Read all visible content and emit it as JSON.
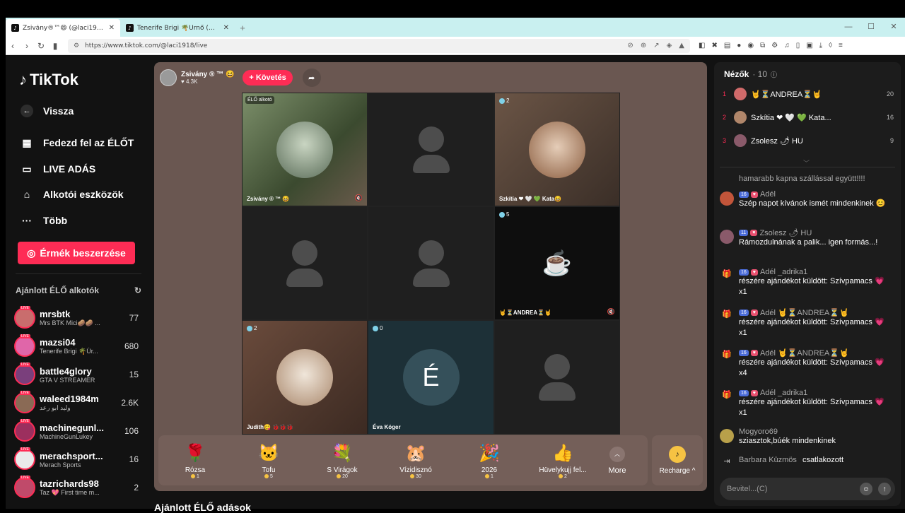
{
  "browser": {
    "tabs": [
      {
        "title": "Zsivány®™😄 (@laci1918) É..."
      },
      {
        "title": "Tenerife Brigi 🌴Ürnő (@mazsi04) É..."
      }
    ],
    "url": "https://www.tiktok.com/@laci1918/live"
  },
  "sidebar": {
    "logo": "TikTok",
    "back": "Vissza",
    "nav": [
      "Fedezd fel az ÉLŐT",
      "LIVE ADÁS",
      "Alkotói eszközök",
      "Több"
    ],
    "coins_button": "Érmék beszerzése",
    "recommended_title": "Ajánlott ÉLŐ alkotók",
    "creators": [
      {
        "name": "mrsbtk",
        "sub": "Mrs BTK Mici🥔🥔 ...",
        "count": "77"
      },
      {
        "name": "mazsi04",
        "sub": "Tenerife Brigi 🌴Úr...",
        "count": "680"
      },
      {
        "name": "battle4glory",
        "sub": "GTA V STREAMER",
        "count": "15"
      },
      {
        "name": "waleed1984m",
        "sub": "وليد ابو رعد",
        "count": "2.6K"
      },
      {
        "name": "machinegunl...",
        "sub": "MachineGunLukey",
        "count": "106"
      },
      {
        "name": "merachsport...",
        "sub": "Merach Sports",
        "count": "16"
      },
      {
        "name": "tazrichards98",
        "sub": "Taz 💖 First time m...",
        "count": "2"
      }
    ]
  },
  "live": {
    "host_name": "Zsivány ® ™ 😆",
    "host_likes": "♥ 4.3K",
    "follow_label": "+ Követés",
    "cells": [
      {
        "label": "Zsivány ® ™ 😆",
        "badge": "",
        "tag": "ÉLŐ alkotó",
        "muted": true
      },
      {
        "label": "",
        "badge": "",
        "tag": "",
        "muted": false
      },
      {
        "label": "Szkítia ❤ 🤍 💚 Kata😆",
        "badge": "2",
        "tag": "",
        "muted": false
      },
      {
        "label": "",
        "badge": "",
        "tag": "",
        "muted": false
      },
      {
        "label": "",
        "badge": "",
        "tag": "",
        "muted": false
      },
      {
        "label": "🤘⏳ANDREA⏳🤘",
        "badge": "5",
        "tag": "",
        "muted": true
      },
      {
        "label": "Judith😋 🐞🐞🐞",
        "badge": "2",
        "tag": "",
        "muted": false
      },
      {
        "label": "Éva Kóger",
        "badge": "0",
        "tag": "",
        "muted": false,
        "initial": "É"
      },
      {
        "label": "",
        "badge": "",
        "tag": "",
        "muted": false
      }
    ],
    "gifts": [
      {
        "name": "Rózsa",
        "price": "1",
        "icon": "🌹"
      },
      {
        "name": "Tofu",
        "price": "5",
        "icon": "🐱"
      },
      {
        "name": "S Virágok",
        "price": "20",
        "icon": "💐"
      },
      {
        "name": "Vízidisznó",
        "price": "30",
        "icon": "🐹"
      },
      {
        "name": "2026",
        "price": "1",
        "icon": "🎉"
      },
      {
        "name": "Hüvelykujj fel...",
        "price": "2",
        "icon": "👍"
      }
    ],
    "more_label": "More",
    "recharge_label": "Recharge ^",
    "below_title": "Ajánlott ÉLŐ adások"
  },
  "chat": {
    "viewers_title": "Nézők",
    "viewers_count": "· 10",
    "viewers": [
      {
        "rank": "1",
        "name": "🤘⏳ANDREA⏳🤘",
        "score": "20"
      },
      {
        "rank": "2",
        "name": "Szkítia ❤ 🤍 💚 Kata...",
        "score": "16"
      },
      {
        "rank": "3",
        "name": "Zsolesz 🌶 HU",
        "score": "9"
      }
    ],
    "messages": [
      {
        "user": "",
        "level": "",
        "text": "hamarabb kapna szállással együtt!!!!"
      },
      {
        "user": "Adél",
        "level": "16",
        "text": "Szép napot kívánok ismét mindenkinek 😊"
      },
      {
        "user": "Zsolesz 🌶 HU",
        "level": "11",
        "text": "Rámozdulnának a palik... igen formás...!"
      },
      {
        "user": "Adél _adrika1",
        "level": "16",
        "text": "részére ajándékot küldött: Szívpamacs 💗 x1"
      },
      {
        "user": "Adél 🤘⏳ANDREA⏳🤘",
        "level": "16",
        "text": "részére ajándékot küldött: Szívpamacs 💗 x1"
      },
      {
        "user": "Adél 🤘⏳ANDREA⏳🤘",
        "level": "16",
        "text": "részére ajándékot küldött: Szívpamacs 💗 x4"
      },
      {
        "user": "Adél _adrika1",
        "level": "16",
        "text": "részére ajándékot küldött: Szívpamacs 💗 x1"
      },
      {
        "user": "Mogyoro69",
        "level": "",
        "text": "sziasztok,búék mindenkinek"
      }
    ],
    "joined_user": "Barbara Küzmös",
    "joined_text": "csatlakozott",
    "input_placeholder": "Bevitel...(C)"
  },
  "colors": {
    "accent": "#fe2c55",
    "live_bg": "#6a5751",
    "panel_bg": "#1c1c1c"
  }
}
